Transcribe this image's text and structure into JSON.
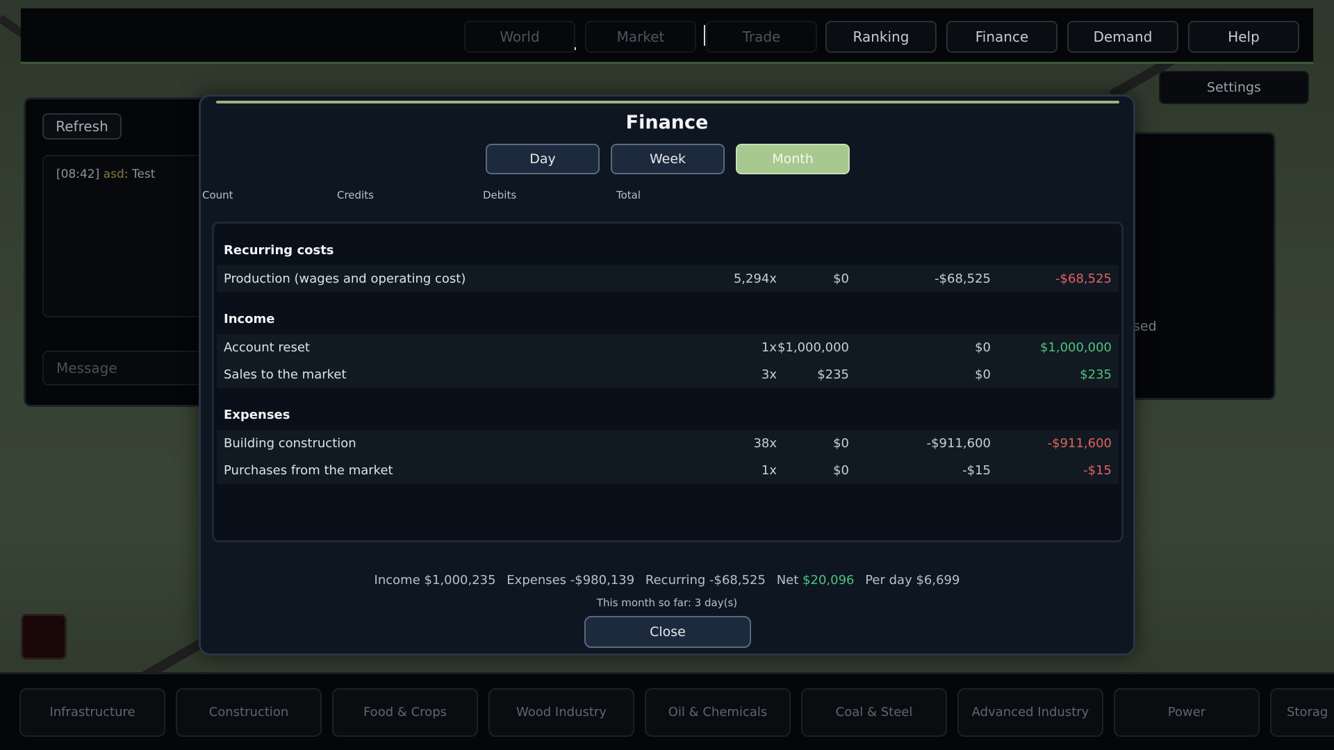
{
  "top_nav": {
    "items": [
      "World",
      "Market",
      "Trade",
      "Ranking",
      "Finance",
      "Demand",
      "Help"
    ]
  },
  "settings_label": "Settings",
  "chat": {
    "refresh_label": "Refresh",
    "log_time": "[08:42]",
    "log_user": "asd",
    "log_message": ": Test",
    "message_placeholder": "Message"
  },
  "right_panel_text": "sed",
  "finance": {
    "title": "Finance",
    "periods": [
      "Day",
      "Week",
      "Month"
    ],
    "active_period": "Month",
    "columns": [
      "Count",
      "Credits",
      "Debits",
      "Total"
    ],
    "sections": [
      {
        "title": "Recurring costs",
        "rows": [
          {
            "label": "Production (wages and operating cost)",
            "count": "5,294x",
            "credits": "$0",
            "debits": "-$68,525",
            "total": "-$68,525"
          }
        ]
      },
      {
        "title": "Income",
        "rows": [
          {
            "label": "Account reset",
            "count": "1x",
            "credits": "$1,000,000",
            "debits": "$0",
            "total": "$1,000,000"
          },
          {
            "label": "Sales to the market",
            "count": "3x",
            "credits": "$235",
            "debits": "$0",
            "total": "$235"
          }
        ]
      },
      {
        "title": "Expenses",
        "rows": [
          {
            "label": "Building construction",
            "count": "38x",
            "credits": "$0",
            "debits": "-$911,600",
            "total": "-$911,600"
          },
          {
            "label": "Purchases from the market",
            "count": "1x",
            "credits": "$0",
            "debits": "-$15",
            "total": "-$15"
          }
        ]
      }
    ],
    "summary": {
      "income": "Income $1,000,235",
      "expenses": "Expenses -$980,139",
      "recurring": "Recurring -$68,525",
      "net_label": "Net",
      "net_value": "$20,096",
      "per_day": "Per day $6,699"
    },
    "month_note": "This month so far: 3 day(s)",
    "close_label": "Close"
  },
  "categories": [
    "Infrastructure",
    "Construction",
    "Food & Crops",
    "Wood Industry",
    "Oil & Chemicals",
    "Coal & Steel",
    "Advanced Industry",
    "Power",
    "Storag"
  ],
  "colors": {
    "positive": "#4fc27a",
    "negative": "#e0635a",
    "accent": "#a7c98f"
  }
}
